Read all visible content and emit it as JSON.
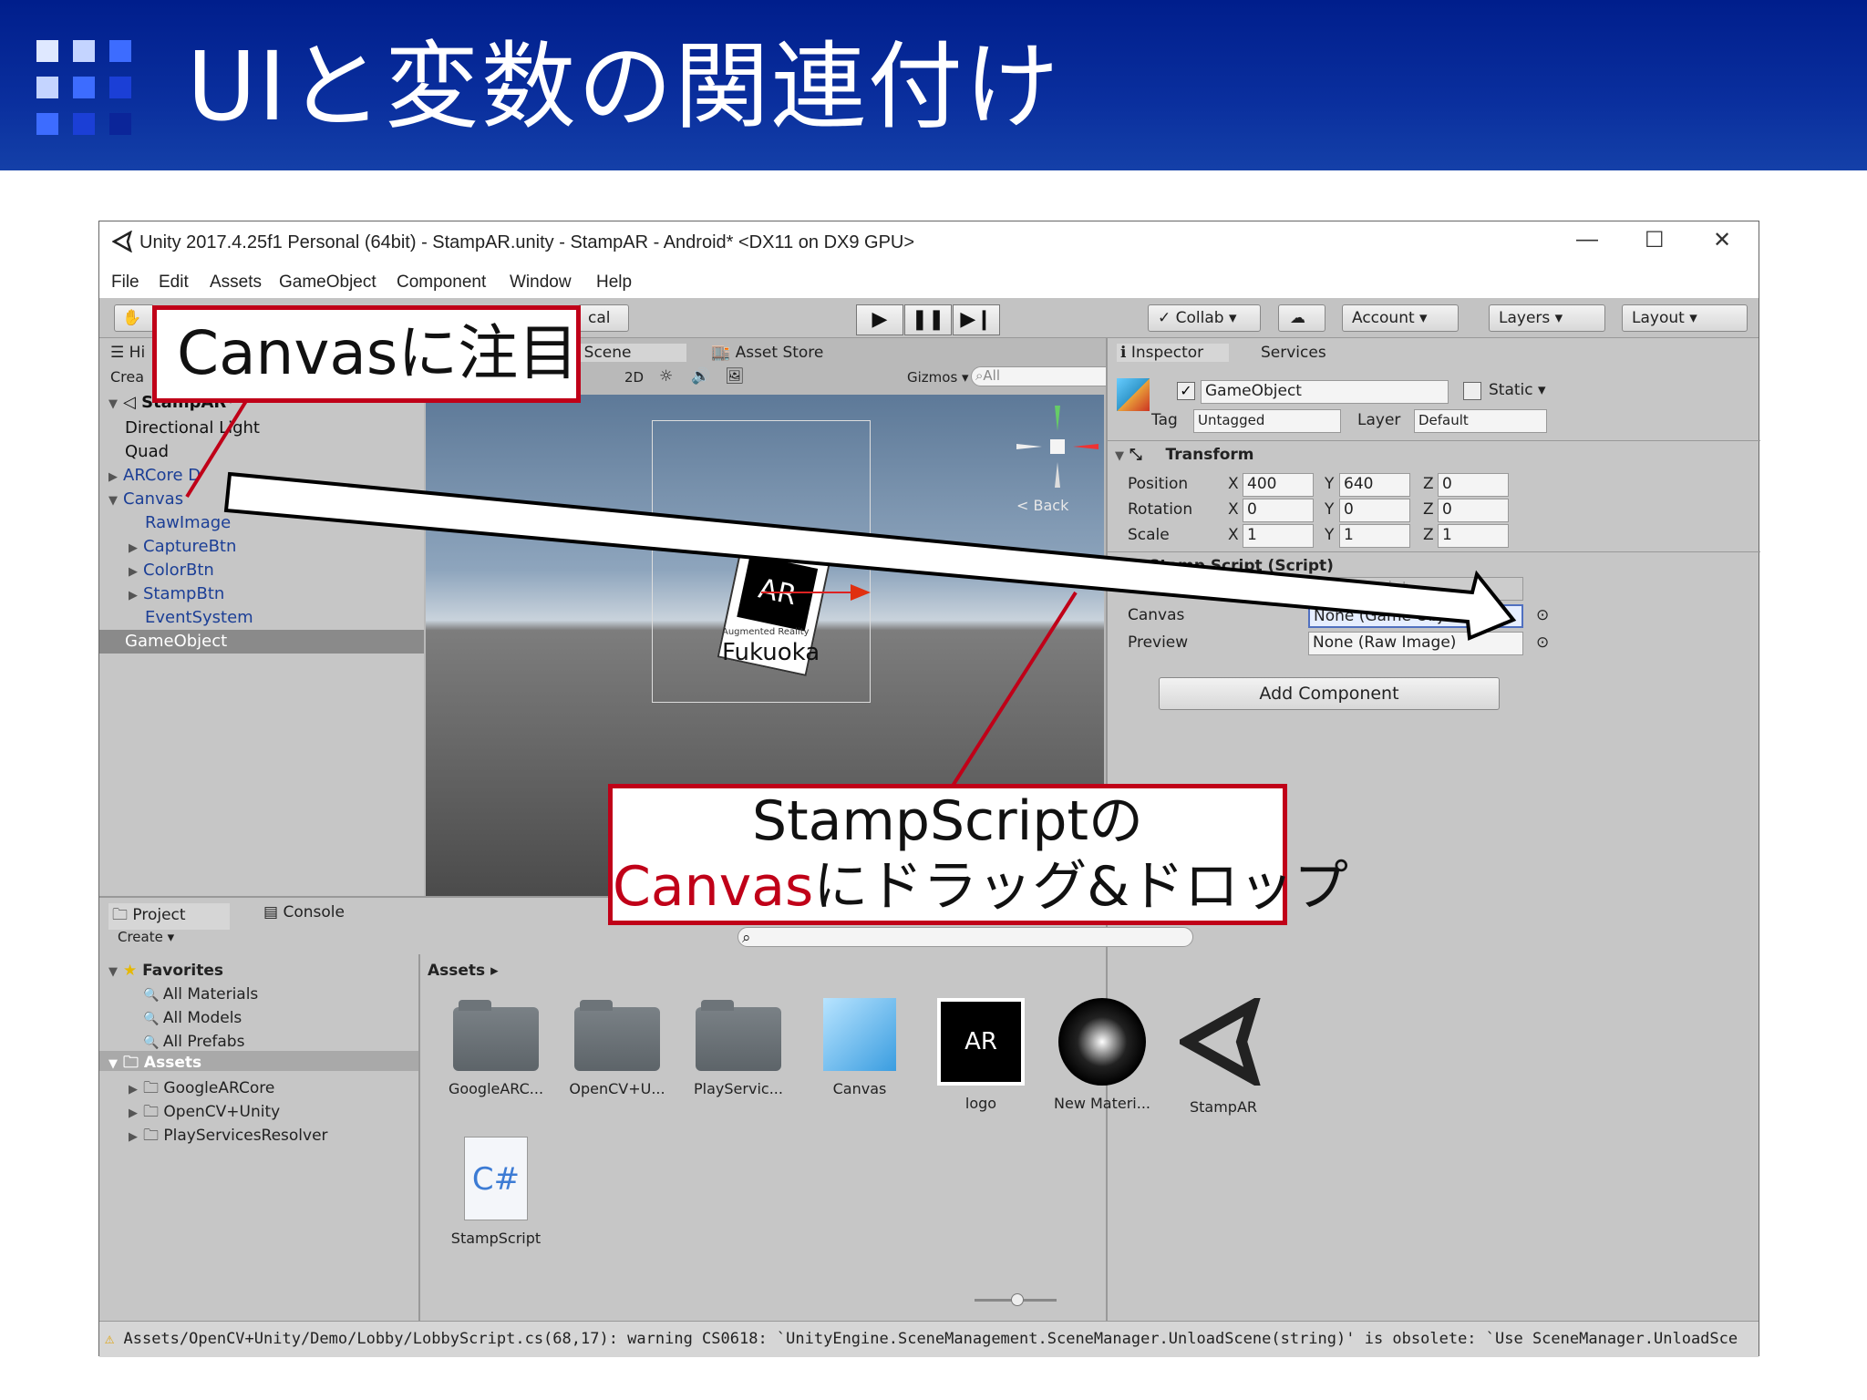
{
  "slide": {
    "title": "UIと変数の関連付け"
  },
  "window": {
    "title": "Unity 2017.4.25f1 Personal (64bit) - StampAR.unity - StampAR - Android* <DX11 on DX9 GPU>",
    "controls": {
      "minimize": "—",
      "maximize": "☐",
      "close": "✕"
    }
  },
  "menu": [
    "File",
    "Edit",
    "Assets",
    "GameObject",
    "Component",
    "Window",
    "Help"
  ],
  "toolbar": {
    "pivot_partial": "cal",
    "collab": "Collab",
    "account": "Account",
    "layers": "Layers",
    "layout": "Layout"
  },
  "hierarchy": {
    "tab_partial": "Hi",
    "create_partial": "Crea",
    "scene": "StampAR*",
    "items": [
      {
        "label": "Directional Light",
        "indent": 0,
        "arrow": false,
        "blue": false
      },
      {
        "label": "Quad",
        "indent": 0,
        "arrow": false,
        "blue": false
      },
      {
        "label": "ARCore D",
        "indent": 0,
        "arrow": true,
        "blue": true
      },
      {
        "label": "Canvas",
        "indent": 0,
        "arrow": true,
        "blue": true,
        "open": true
      },
      {
        "label": "RawImage",
        "indent": 1,
        "arrow": false,
        "blue": true
      },
      {
        "label": "CaptureBtn",
        "indent": 1,
        "arrow": true,
        "blue": true
      },
      {
        "label": "ColorBtn",
        "indent": 1,
        "arrow": true,
        "blue": true
      },
      {
        "label": "StampBtn",
        "indent": 1,
        "arrow": true,
        "blue": true
      },
      {
        "label": "EventSystem",
        "indent": 1,
        "arrow": false,
        "blue": true
      },
      {
        "label": "GameObject",
        "indent": 0,
        "arrow": false,
        "blue": false,
        "selected": true
      }
    ]
  },
  "scene": {
    "tabs": [
      "Scene",
      "Asset Store"
    ],
    "mode_2d": "2D",
    "gizmos": "Gizmos",
    "search_placeholder": "All",
    "back_label": "Back",
    "marker_text": "AR",
    "marker_sub": "Augmented Reality",
    "marker_city": "Fukuoka"
  },
  "inspector": {
    "tabs": [
      "Inspector",
      "Services"
    ],
    "object_name": "GameObject",
    "static_label": "Static",
    "tag_label": "Tag",
    "tag_value": "Untagged",
    "layer_label": "Layer",
    "layer_value": "Default",
    "transform": {
      "title": "Transform",
      "rows": [
        {
          "label": "Position",
          "x": "400",
          "y": "640",
          "z": "0"
        },
        {
          "label": "Rotation",
          "x": "0",
          "y": "0",
          "z": "0"
        },
        {
          "label": "Scale",
          "x": "1",
          "y": "1",
          "z": "1"
        }
      ]
    },
    "script": {
      "title": "Stamp Script (Script)",
      "script_field": "StampScript",
      "canvas_label": "Canvas",
      "canvas_value": "None (Game Object)",
      "preview_label": "Preview",
      "preview_value": "None (Raw Image)"
    },
    "add_component": "Add Component"
  },
  "project": {
    "tabs": [
      "Project",
      "Console"
    ],
    "create": "Create",
    "breadcrumb": "Assets",
    "favorites": {
      "title": "Favorites",
      "items": [
        "All Materials",
        "All Models",
        "All Prefabs"
      ]
    },
    "assets_tree": {
      "title": "Assets",
      "items": [
        "GoogleARCore",
        "OpenCV+Unity",
        "PlayServicesResolver"
      ]
    },
    "assets_grid": [
      {
        "label": "GoogleARC...",
        "icon": "folder-icon"
      },
      {
        "label": "OpenCV+U...",
        "icon": "folder-icon"
      },
      {
        "label": "PlayServic...",
        "icon": "folder-icon"
      },
      {
        "label": "Canvas",
        "icon": "prefab-cube-icon"
      },
      {
        "label": "logo",
        "icon": "ar-logo-texture-icon"
      },
      {
        "label": "New Materi...",
        "icon": "material-icon"
      },
      {
        "label": "StampAR",
        "icon": "unity-scene-icon"
      },
      {
        "label": "StampScript",
        "icon": "csharp-script-icon"
      }
    ]
  },
  "status": {
    "message": "Assets/OpenCV+Unity/Demo/Lobby/LobbyScript.cs(68,17): warning CS0618: `UnityEngine.SceneManagement.SceneManager.UnloadScene(string)' is obsolete: `Use SceneManager.UnloadSce"
  },
  "callouts": {
    "canvas_focus": "Canvasに注目",
    "drag_line1": "StampScriptの",
    "drag_line2_red": "Canvas",
    "drag_line2_rest": "にドラッグ&ドロップ"
  },
  "colors": {
    "banner": "#0a2f9e",
    "callout_border": "#c00018",
    "selection": "#5070c0"
  }
}
